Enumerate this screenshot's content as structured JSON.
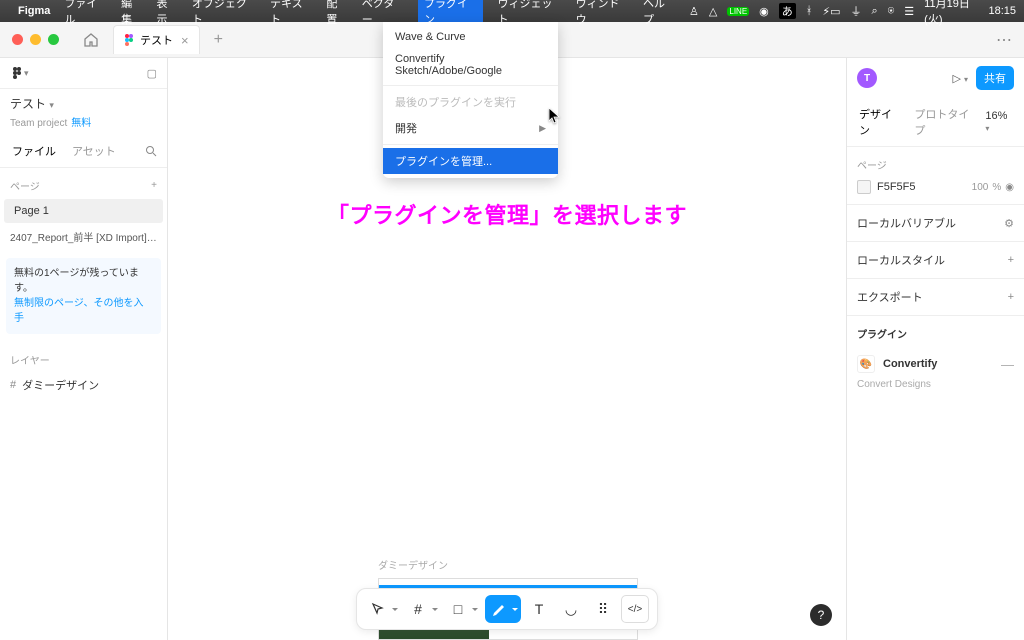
{
  "menubar": {
    "app": "Figma",
    "items": [
      "ファイル",
      "編集",
      "表示",
      "オブジェクト",
      "テキスト",
      "配置",
      "ベクター",
      "プラグイン",
      "ウィジェット",
      "ウィンドウ",
      "ヘルプ"
    ],
    "active_index": 7,
    "date": "11月19日(火)",
    "time": "18:15"
  },
  "dropdown": {
    "items": [
      {
        "label": "Wave & Curve",
        "kind": "item"
      },
      {
        "label": "Convertify Sketch/Adobe/Google",
        "kind": "item"
      },
      {
        "kind": "sep"
      },
      {
        "label": "最後のプラグインを実行",
        "kind": "disabled"
      },
      {
        "label": "開発",
        "kind": "submenu"
      },
      {
        "kind": "sep"
      },
      {
        "label": "プラグインを管理...",
        "kind": "highlight"
      }
    ]
  },
  "doctab": {
    "name": "テスト"
  },
  "project": {
    "name": "テスト",
    "team": "Team project",
    "free_label": "無料"
  },
  "left": {
    "file_tab": "ファイル",
    "asset_tab": "アセット",
    "pages_label": "ページ",
    "page1": "Page 1",
    "import_row": "2407_Report_前半  [XD Import] (30-Ju...",
    "promo_line1": "無料の1ページが残っています。",
    "promo_link": "無制限のページ、その他を入手",
    "layers_label": "レイヤー",
    "layer1": "ダミーデザイン"
  },
  "canvas": {
    "tutorial_text": "「プラグインを管理」を選択します",
    "frame_label": "ダミーデザイン"
  },
  "right": {
    "avatar_letter": "T",
    "share_label": "共有",
    "tab_design": "デザイン",
    "tab_proto": "プロトタイプ",
    "zoom": "16%",
    "page_label": "ページ",
    "bg_hex": "F5F5F5",
    "bg_opacity": "100",
    "bg_opacity_unit": "%",
    "local_vars": "ローカルバリアブル",
    "local_styles": "ローカルスタイル",
    "export": "エクスポート",
    "plugin_label": "プラグイン",
    "plugin_name": "Convertify",
    "plugin_desc": "Convert Designs"
  }
}
